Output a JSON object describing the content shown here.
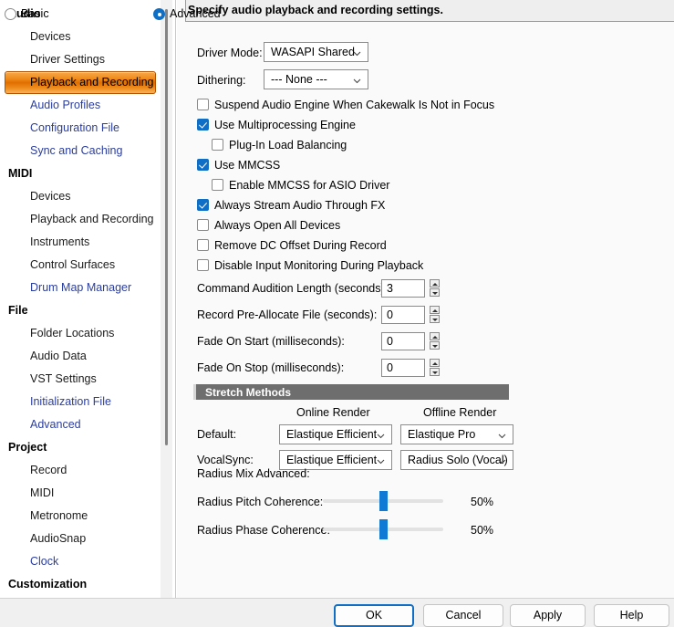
{
  "header": {
    "title": "Specify audio playback and recording settings."
  },
  "sidebar": {
    "sections": [
      {
        "group": "Audio",
        "items": [
          {
            "label": "Devices",
            "style": "normal",
            "selected": false
          },
          {
            "label": "Driver Settings",
            "style": "normal",
            "selected": false
          },
          {
            "label": "Playback and Recording",
            "style": "normal",
            "selected": true
          },
          {
            "label": "Audio Profiles",
            "style": "link",
            "selected": false
          },
          {
            "label": "Configuration File",
            "style": "link",
            "selected": false
          },
          {
            "label": "Sync and Caching",
            "style": "link",
            "selected": false
          }
        ]
      },
      {
        "group": "MIDI",
        "items": [
          {
            "label": "Devices",
            "style": "normal",
            "selected": false
          },
          {
            "label": "Playback and Recording",
            "style": "normal",
            "selected": false
          },
          {
            "label": "Instruments",
            "style": "normal",
            "selected": false
          },
          {
            "label": "Control Surfaces",
            "style": "normal",
            "selected": false
          },
          {
            "label": "Drum Map Manager",
            "style": "link",
            "selected": false
          }
        ]
      },
      {
        "group": "File",
        "items": [
          {
            "label": "Folder Locations",
            "style": "normal",
            "selected": false
          },
          {
            "label": "Audio Data",
            "style": "normal",
            "selected": false
          },
          {
            "label": "VST Settings",
            "style": "normal",
            "selected": false
          },
          {
            "label": "Initialization File",
            "style": "link",
            "selected": false
          },
          {
            "label": "Advanced",
            "style": "link",
            "selected": false
          }
        ]
      },
      {
        "group": "Project",
        "items": [
          {
            "label": "Record",
            "style": "normal",
            "selected": false
          },
          {
            "label": "MIDI",
            "style": "normal",
            "selected": false
          },
          {
            "label": "Metronome",
            "style": "normal",
            "selected": false
          },
          {
            "label": "AudioSnap",
            "style": "normal",
            "selected": false
          },
          {
            "label": "Clock",
            "style": "link",
            "selected": false
          }
        ]
      },
      {
        "group": "Customization",
        "items": []
      }
    ]
  },
  "main": {
    "driver_mode": {
      "label": "Driver Mode:",
      "value": "WASAPI Shared"
    },
    "dithering": {
      "label": "Dithering:",
      "value": "--- None ---"
    },
    "checkboxes": [
      {
        "label": "Suspend Audio Engine When Cakewalk Is Not in Focus",
        "checked": false,
        "indent": 0
      },
      {
        "label": "Use Multiprocessing Engine",
        "checked": true,
        "indent": 0
      },
      {
        "label": "Plug-In Load Balancing",
        "checked": false,
        "indent": 1
      },
      {
        "label": "Use MMCSS",
        "checked": true,
        "indent": 0
      },
      {
        "label": "Enable MMCSS for ASIO Driver",
        "checked": false,
        "indent": 1
      },
      {
        "label": "Always Stream Audio Through FX",
        "checked": true,
        "indent": 0
      },
      {
        "label": "Always Open All Devices",
        "checked": false,
        "indent": 0
      },
      {
        "label": "Remove DC Offset During Record",
        "checked": false,
        "indent": 0
      },
      {
        "label": "Disable Input Monitoring During Playback",
        "checked": false,
        "indent": 0
      }
    ],
    "spinners": [
      {
        "label": "Command Audition Length (seconds):",
        "value": "3"
      },
      {
        "label": "Record Pre-Allocate File (seconds):",
        "value": "0"
      },
      {
        "label": "Fade On Start  (milliseconds):",
        "value": "0"
      },
      {
        "label": "Fade On Stop  (milliseconds):",
        "value": "0"
      }
    ],
    "stretch": {
      "group_title": "Stretch Methods",
      "col_online": "Online Render",
      "col_offline": "Offline Render",
      "rows": [
        {
          "label": "Default:",
          "online": "Elastique Efficient",
          "offline": "Elastique Pro"
        },
        {
          "label": "VocalSync:",
          "online": "Elastique Efficient",
          "offline": "Radius Solo (Vocal)"
        }
      ]
    },
    "radius": {
      "section_label": "Radius Mix Advanced:",
      "sliders": [
        {
          "label": "Radius Pitch Coherence:",
          "value": "50%",
          "percent": 50
        },
        {
          "label": "Radius Phase Coherence:",
          "value": "50%",
          "percent": 50
        }
      ]
    }
  },
  "footer": {
    "mode_basic": "Basic",
    "mode_advanced": "Advanced",
    "mode_selected": "Advanced",
    "buttons": [
      {
        "label": "OK",
        "primary": true
      },
      {
        "label": "Cancel",
        "primary": false
      },
      {
        "label": "Apply",
        "primary": false
      },
      {
        "label": "Help",
        "primary": false
      }
    ]
  },
  "colors": {
    "accent_blue": "#0f6fc6",
    "selected_orange": "#e06f00",
    "link_blue": "#2b3e9e",
    "group_header_gray": "#6e6e6e"
  }
}
